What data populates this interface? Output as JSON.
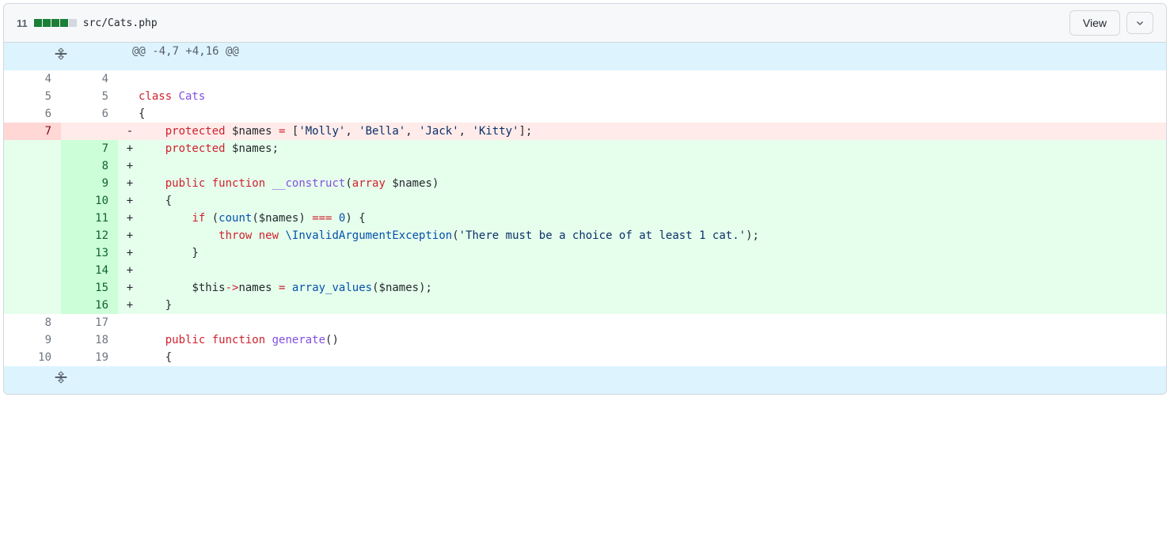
{
  "header": {
    "diffCount": "11",
    "blocks": [
      "added",
      "added",
      "added",
      "added",
      "neutral"
    ],
    "fileName": "src/Cats.php",
    "viewLabel": "View"
  },
  "hunkHeader": "@@ -4,7 +4,16 @@",
  "lines": [
    {
      "type": "context",
      "old": "4",
      "new": "4",
      "marker": " ",
      "tokens": []
    },
    {
      "type": "context",
      "old": "5",
      "new": "5",
      "marker": " ",
      "tokens": [
        {
          "t": "class ",
          "c": "pl-k"
        },
        {
          "t": "Cats",
          "c": "pl-en"
        }
      ]
    },
    {
      "type": "context",
      "old": "6",
      "new": "6",
      "marker": " ",
      "tokens": [
        {
          "t": "{",
          "c": ""
        }
      ]
    },
    {
      "type": "deletion",
      "old": "7",
      "new": "",
      "marker": "-",
      "tokens": [
        {
          "t": "    ",
          "c": ""
        },
        {
          "t": "protected",
          "c": "pl-k"
        },
        {
          "t": " ",
          "c": ""
        },
        {
          "t": "$names",
          "c": "pl-smi"
        },
        {
          "t": " ",
          "c": ""
        },
        {
          "t": "=",
          "c": "pl-k"
        },
        {
          "t": " [",
          "c": ""
        },
        {
          "t": "'Molly'",
          "c": "pl-s"
        },
        {
          "t": ", ",
          "c": ""
        },
        {
          "t": "'Bella'",
          "c": "pl-s"
        },
        {
          "t": ", ",
          "c": ""
        },
        {
          "t": "'Jack'",
          "c": "pl-s"
        },
        {
          "t": ", ",
          "c": ""
        },
        {
          "t": "'Kitty'",
          "c": "pl-s"
        },
        {
          "t": "];",
          "c": ""
        }
      ]
    },
    {
      "type": "addition",
      "old": "",
      "new": "7",
      "marker": "+",
      "tokens": [
        {
          "t": "    ",
          "c": ""
        },
        {
          "t": "protected",
          "c": "pl-k"
        },
        {
          "t": " ",
          "c": ""
        },
        {
          "t": "$names",
          "c": "pl-smi"
        },
        {
          "t": ";",
          "c": ""
        }
      ]
    },
    {
      "type": "addition",
      "old": "",
      "new": "8",
      "marker": "+",
      "tokens": []
    },
    {
      "type": "addition",
      "old": "",
      "new": "9",
      "marker": "+",
      "tokens": [
        {
          "t": "    ",
          "c": ""
        },
        {
          "t": "public",
          "c": "pl-k"
        },
        {
          "t": " ",
          "c": ""
        },
        {
          "t": "function",
          "c": "pl-k"
        },
        {
          "t": " ",
          "c": ""
        },
        {
          "t": "__construct",
          "c": "pl-en"
        },
        {
          "t": "(",
          "c": ""
        },
        {
          "t": "array",
          "c": "pl-k"
        },
        {
          "t": " ",
          "c": ""
        },
        {
          "t": "$names",
          "c": "pl-smi"
        },
        {
          "t": ")",
          "c": ""
        }
      ]
    },
    {
      "type": "addition",
      "old": "",
      "new": "10",
      "marker": "+",
      "tokens": [
        {
          "t": "    {",
          "c": ""
        }
      ]
    },
    {
      "type": "addition",
      "old": "",
      "new": "11",
      "marker": "+",
      "tokens": [
        {
          "t": "        ",
          "c": ""
        },
        {
          "t": "if",
          "c": "pl-k"
        },
        {
          "t": " (",
          "c": ""
        },
        {
          "t": "count",
          "c": "pl-c1"
        },
        {
          "t": "(",
          "c": ""
        },
        {
          "t": "$names",
          "c": "pl-smi"
        },
        {
          "t": ") ",
          "c": ""
        },
        {
          "t": "===",
          "c": "pl-k"
        },
        {
          "t": " ",
          "c": ""
        },
        {
          "t": "0",
          "c": "pl-c1"
        },
        {
          "t": ") {",
          "c": ""
        }
      ]
    },
    {
      "type": "addition",
      "old": "",
      "new": "12",
      "marker": "+",
      "tokens": [
        {
          "t": "            ",
          "c": ""
        },
        {
          "t": "throw",
          "c": "pl-k"
        },
        {
          "t": " ",
          "c": ""
        },
        {
          "t": "new",
          "c": "pl-k"
        },
        {
          "t": " ",
          "c": ""
        },
        {
          "t": "\\InvalidArgumentException",
          "c": "pl-c1"
        },
        {
          "t": "(",
          "c": ""
        },
        {
          "t": "'There must be a choice of at least 1 cat.'",
          "c": "pl-s"
        },
        {
          "t": ");",
          "c": ""
        }
      ]
    },
    {
      "type": "addition",
      "old": "",
      "new": "13",
      "marker": "+",
      "tokens": [
        {
          "t": "        }",
          "c": ""
        }
      ]
    },
    {
      "type": "addition",
      "old": "",
      "new": "14",
      "marker": "+",
      "tokens": []
    },
    {
      "type": "addition",
      "old": "",
      "new": "15",
      "marker": "+",
      "tokens": [
        {
          "t": "        ",
          "c": ""
        },
        {
          "t": "$this",
          "c": "pl-smi"
        },
        {
          "t": "->",
          "c": "pl-k"
        },
        {
          "t": "names",
          "c": ""
        },
        {
          "t": " ",
          "c": ""
        },
        {
          "t": "=",
          "c": "pl-k"
        },
        {
          "t": " ",
          "c": ""
        },
        {
          "t": "array_values",
          "c": "pl-c1"
        },
        {
          "t": "(",
          "c": ""
        },
        {
          "t": "$names",
          "c": "pl-smi"
        },
        {
          "t": ");",
          "c": ""
        }
      ]
    },
    {
      "type": "addition",
      "old": "",
      "new": "16",
      "marker": "+",
      "tokens": [
        {
          "t": "    }",
          "c": ""
        }
      ]
    },
    {
      "type": "context",
      "old": "8",
      "new": "17",
      "marker": " ",
      "tokens": []
    },
    {
      "type": "context",
      "old": "9",
      "new": "18",
      "marker": " ",
      "tokens": [
        {
          "t": "    ",
          "c": ""
        },
        {
          "t": "public",
          "c": "pl-k"
        },
        {
          "t": " ",
          "c": ""
        },
        {
          "t": "function",
          "c": "pl-k"
        },
        {
          "t": " ",
          "c": ""
        },
        {
          "t": "generate",
          "c": "pl-en"
        },
        {
          "t": "()",
          "c": ""
        }
      ]
    },
    {
      "type": "context",
      "old": "10",
      "new": "19",
      "marker": " ",
      "tokens": [
        {
          "t": "    {",
          "c": ""
        }
      ]
    }
  ]
}
